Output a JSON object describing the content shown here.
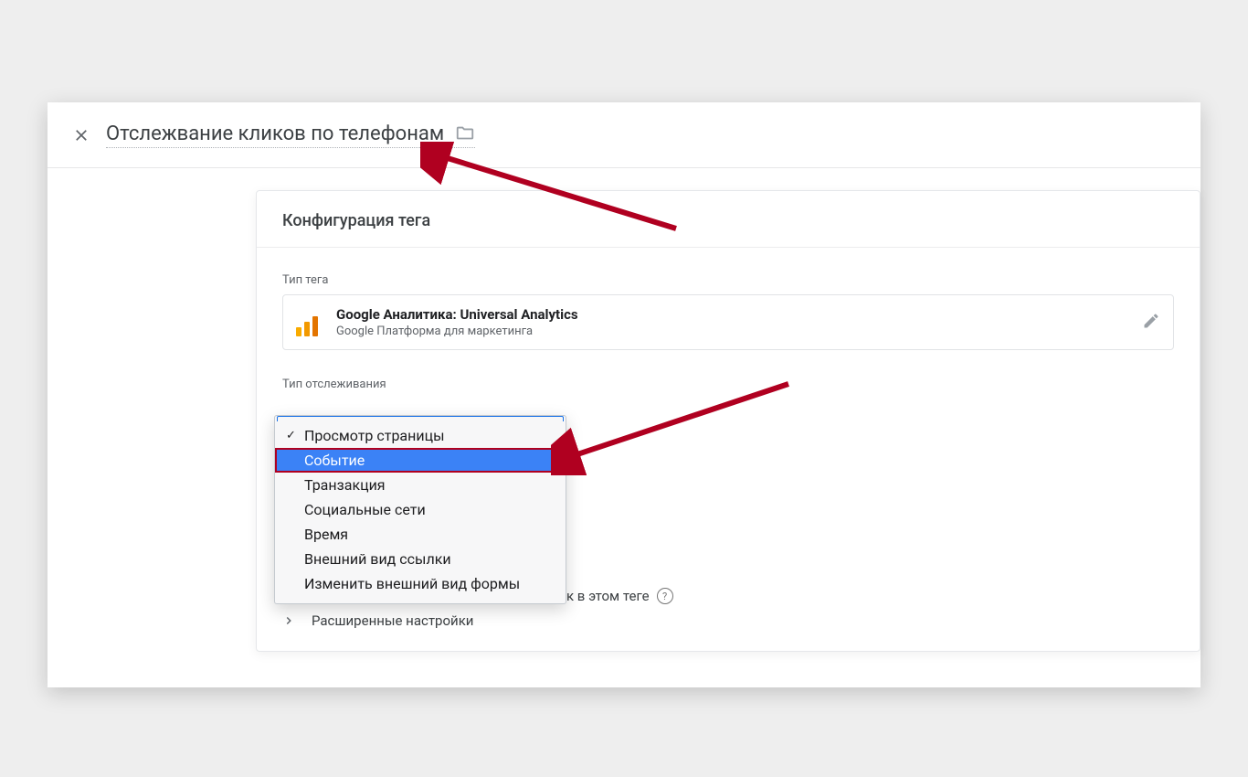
{
  "header": {
    "title": "Отслежвание кликов по телефонам"
  },
  "panel": {
    "title": "Конфигурация тега",
    "tag_type_label": "Тип тега",
    "tag": {
      "name": "Google Аналитика: Universal Analytics",
      "sub": "Google Платформа для маркетинга"
    },
    "tracking_type_label": "Тип отслеживания",
    "override_suffix": "ек в этом теге",
    "advanced_label": "Расширенные настройки"
  },
  "dropdown": {
    "items": [
      {
        "label": "Просмотр страницы",
        "checked": true,
        "highlight": false
      },
      {
        "label": "Событие",
        "checked": false,
        "highlight": true
      },
      {
        "label": "Транзакция",
        "checked": false,
        "highlight": false
      },
      {
        "label": "Социальные сети",
        "checked": false,
        "highlight": false
      },
      {
        "label": "Время",
        "checked": false,
        "highlight": false
      },
      {
        "label": "Внешний вид ссылки",
        "checked": false,
        "highlight": false
      },
      {
        "label": "Изменить внешний вид формы",
        "checked": false,
        "highlight": false
      }
    ]
  }
}
